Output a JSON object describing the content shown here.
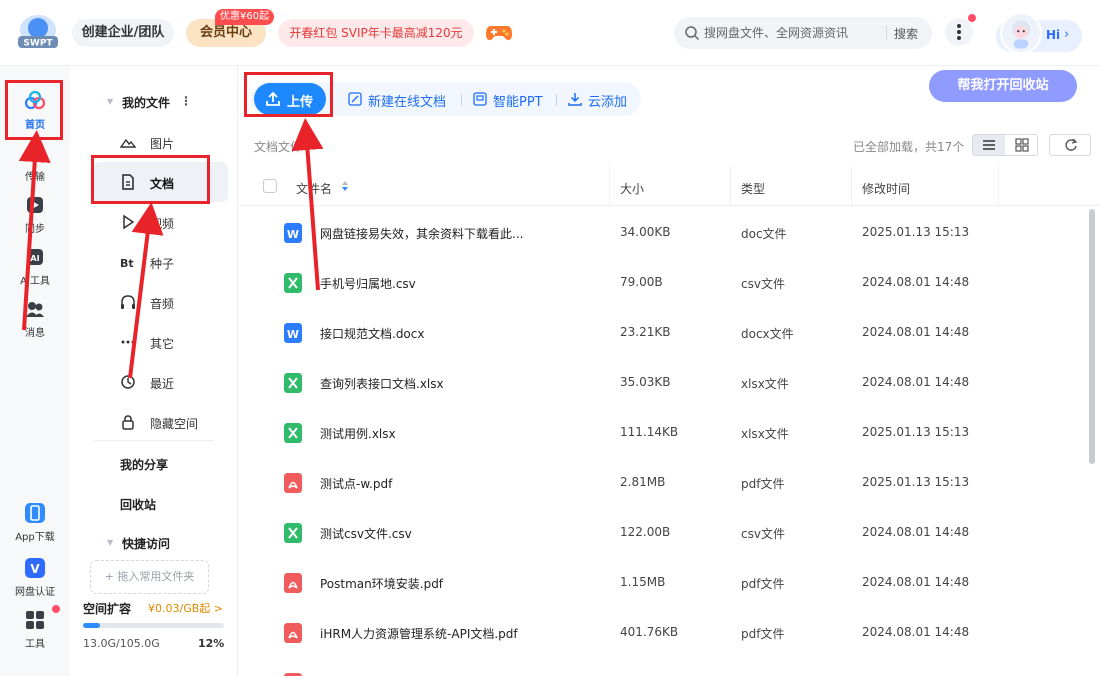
{
  "header": {
    "logo_text": "SWPT",
    "enterprise_label": "创建企业/团队",
    "vip_label": "会员中心",
    "vip_badge": "优惠¥60起",
    "promo_label": "开春红包 SVIP年卡最高减120元",
    "search_placeholder": "搜网盘文件、全网资源资讯",
    "search_button": "搜索",
    "greeting": "Hi"
  },
  "rail": {
    "items": [
      {
        "label": "首页",
        "icon": "cloud-home-icon"
      },
      {
        "label": "传输",
        "icon": "transfer-icon"
      },
      {
        "label": "同步",
        "icon": "sync-icon"
      },
      {
        "label": "AI工具",
        "icon": "ai-tool-icon"
      },
      {
        "label": "消息",
        "icon": "message-icon"
      }
    ],
    "bottom_items": [
      {
        "label": "App下载",
        "icon": "phone-icon"
      },
      {
        "label": "网盘认证",
        "icon": "verified-icon"
      },
      {
        "label": "工具",
        "icon": "grid-tools-icon"
      }
    ]
  },
  "sidebar": {
    "my_files": "我的文件",
    "items": [
      {
        "label": "图片",
        "icon": "image-icon"
      },
      {
        "label": "文档",
        "icon": "document-icon"
      },
      {
        "label": "视频",
        "icon": "video-icon"
      },
      {
        "label": "种子",
        "icon": "torrent-icon"
      },
      {
        "label": "音频",
        "icon": "headphone-icon"
      },
      {
        "label": "其它",
        "icon": "more-icon"
      },
      {
        "label": "最近",
        "icon": "clock-icon"
      },
      {
        "label": "隐藏空间",
        "icon": "lock-icon"
      }
    ],
    "my_share": "我的分享",
    "recycle": "回收站",
    "quick_access": "快捷访问",
    "drop_hint": "+ 拖入常用文件夹",
    "space_title": "空间扩容",
    "space_price": "¥0.03/GB起 >",
    "space_used": "13.0G/105.0G",
    "space_percent": "12%",
    "space_fraction": 0.12
  },
  "toolbar": {
    "upload": "上传",
    "new_doc": "新建在线文档",
    "smart_ppt": "智能PPT",
    "cloud_add": "云添加",
    "recycle_help": "帮我打开回收站"
  },
  "list": {
    "breadcrumb": "文档文件",
    "loaded_status": "已全部加载，共17个",
    "columns": [
      "文件名",
      "大小",
      "类型",
      "修改时间"
    ],
    "rows": [
      {
        "name": "网盘链接易失效，其余资料下载看此...",
        "size": "34.00KB",
        "type": "doc文件",
        "time": "2025.01.13 15:13",
        "kind": "word"
      },
      {
        "name": "手机号归属地.csv",
        "size": "79.00B",
        "type": "csv文件",
        "time": "2024.08.01 14:48",
        "kind": "excel"
      },
      {
        "name": "接口规范文档.docx",
        "size": "23.21KB",
        "type": "docx文件",
        "time": "2024.08.01 14:48",
        "kind": "word"
      },
      {
        "name": "查询列表接口文档.xlsx",
        "size": "35.03KB",
        "type": "xlsx文件",
        "time": "2024.08.01 14:48",
        "kind": "excel"
      },
      {
        "name": "测试用例.xlsx",
        "size": "111.14KB",
        "type": "xlsx文件",
        "time": "2025.01.13 15:13",
        "kind": "excel"
      },
      {
        "name": "测试点-w.pdf",
        "size": "2.81MB",
        "type": "pdf文件",
        "time": "2025.01.13 15:13",
        "kind": "pdf"
      },
      {
        "name": "测试csv文件.csv",
        "size": "122.00B",
        "type": "csv文件",
        "time": "2024.08.01 14:48",
        "kind": "excel"
      },
      {
        "name": "Postman环境安装.pdf",
        "size": "1.15MB",
        "type": "pdf文件",
        "time": "2024.08.01 14:48",
        "kind": "pdf"
      },
      {
        "name": "iHRM人力资源管理系统-API文档.pdf",
        "size": "401.76KB",
        "type": "pdf文件",
        "time": "2024.08.01 14:48",
        "kind": "pdf"
      },
      {
        "name": "",
        "size": "",
        "type": "",
        "time": "",
        "kind": "pdf"
      }
    ]
  },
  "colors": {
    "accent": "#1e88ff",
    "annotation": "#e8232a",
    "word": "#2b7cff",
    "excel": "#2fbb6a",
    "pdf": "#f05b5b"
  }
}
